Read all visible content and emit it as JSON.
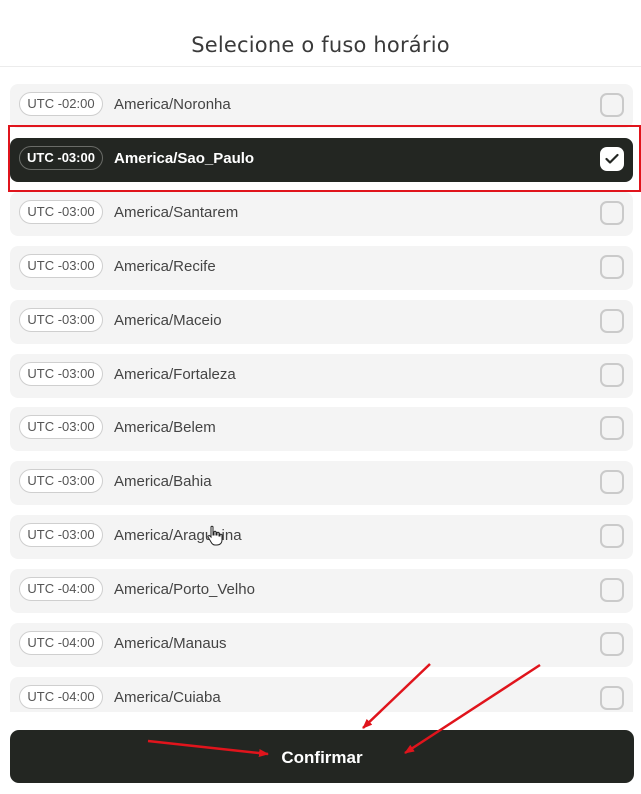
{
  "header": {
    "title": "Selecione o fuso horário"
  },
  "timezones": [
    {
      "offset": "UTC -02:00",
      "name": "America/Noronha",
      "selected": false
    },
    {
      "offset": "UTC -03:00",
      "name": "America/Sao_Paulo",
      "selected": true
    },
    {
      "offset": "UTC -03:00",
      "name": "America/Santarem",
      "selected": false
    },
    {
      "offset": "UTC -03:00",
      "name": "America/Recife",
      "selected": false
    },
    {
      "offset": "UTC -03:00",
      "name": "America/Maceio",
      "selected": false
    },
    {
      "offset": "UTC -03:00",
      "name": "America/Fortaleza",
      "selected": false
    },
    {
      "offset": "UTC -03:00",
      "name": "America/Belem",
      "selected": false
    },
    {
      "offset": "UTC -03:00",
      "name": "America/Bahia",
      "selected": false
    },
    {
      "offset": "UTC -03:00",
      "name": "America/Araguaina",
      "selected": false
    },
    {
      "offset": "UTC -04:00",
      "name": "America/Porto_Velho",
      "selected": false
    },
    {
      "offset": "UTC -04:00",
      "name": "America/Manaus",
      "selected": false
    },
    {
      "offset": "UTC -04:00",
      "name": "America/Cuiaba",
      "selected": false
    }
  ],
  "footer": {
    "confirm_label": "Confirmar"
  },
  "colors": {
    "dark": "#232622",
    "annotation_red": "#e0141c",
    "row_bg": "#f4f4f4"
  }
}
